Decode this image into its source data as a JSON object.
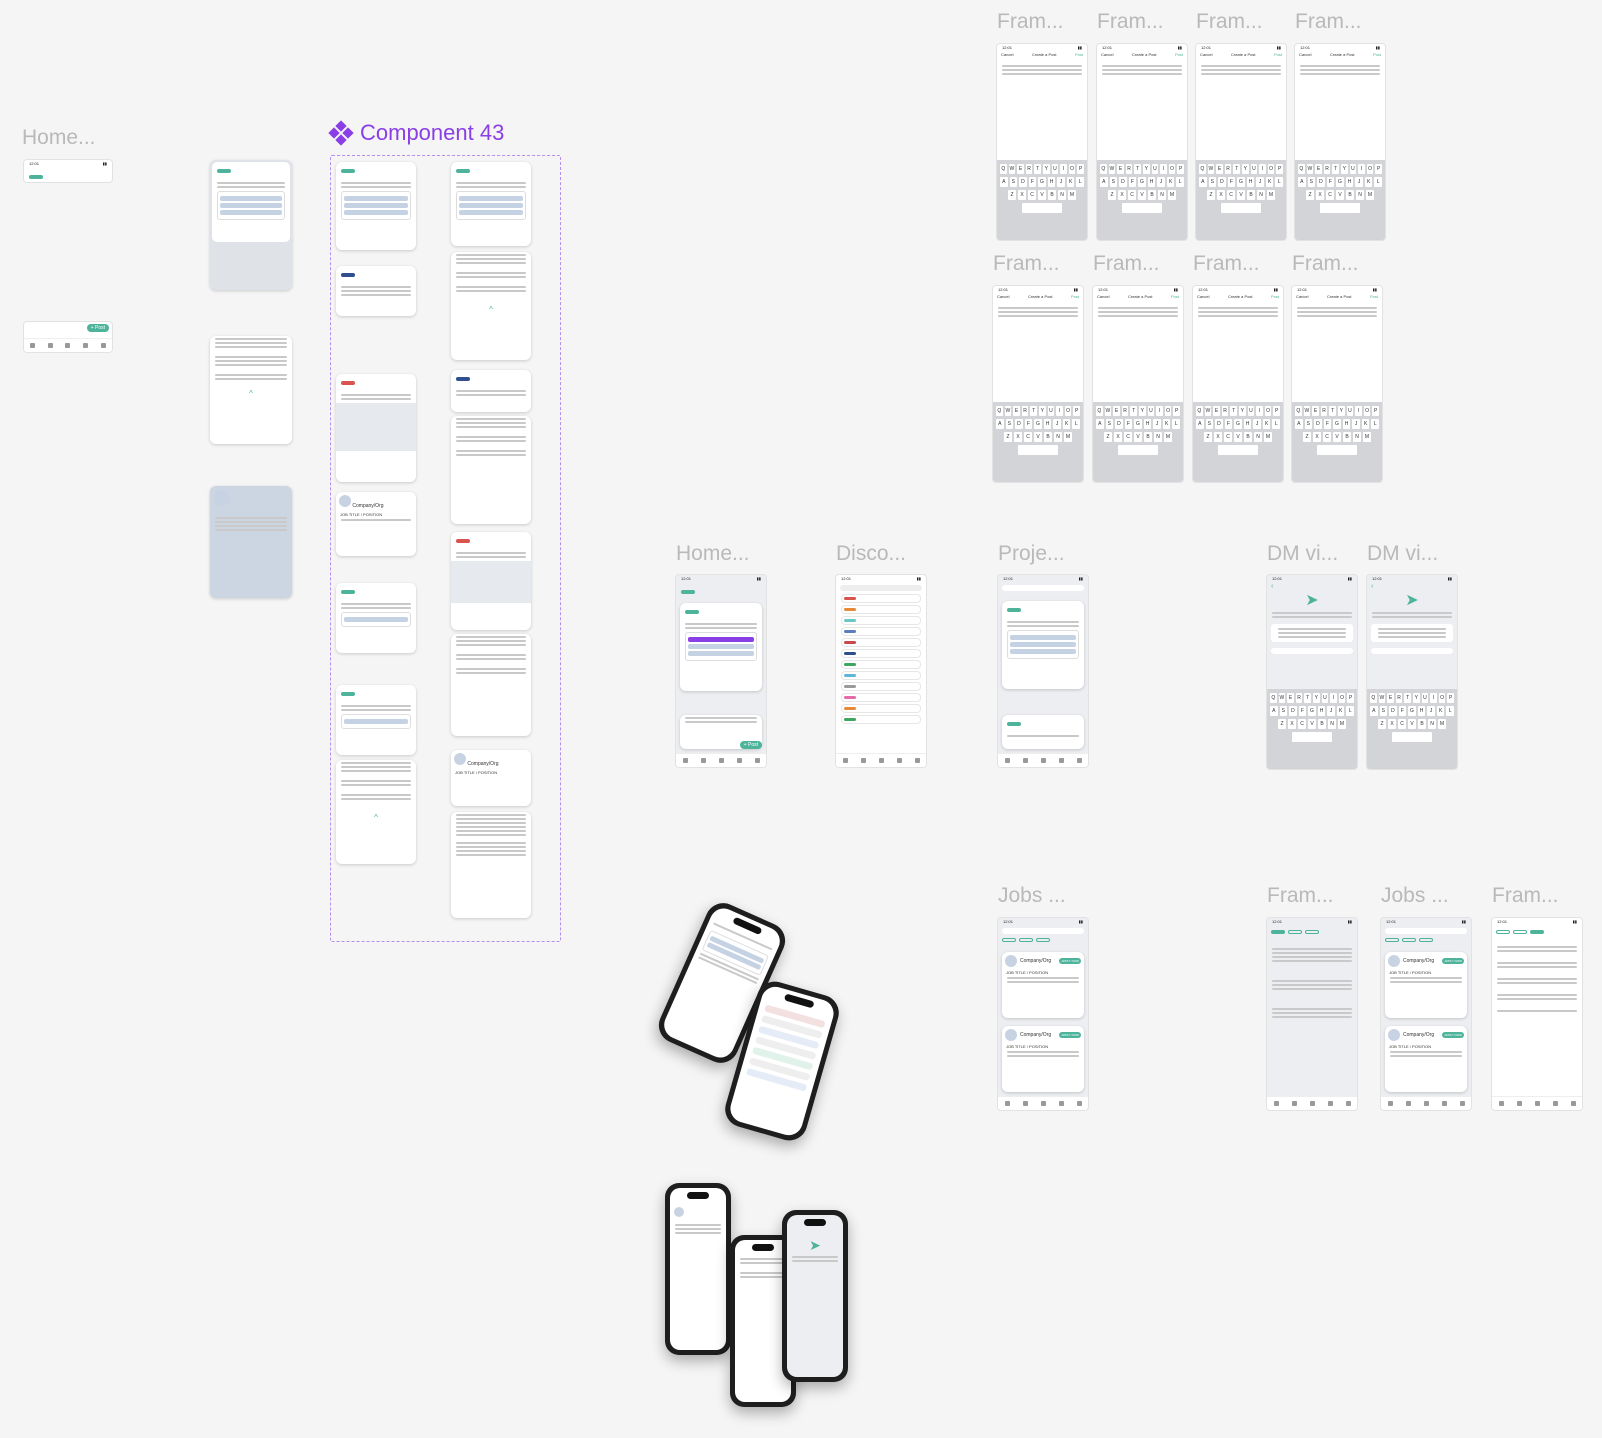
{
  "labels": {
    "home_left": "Home...",
    "component": "Component 43",
    "frame": "Fram...",
    "home": "Home...",
    "discover": "Disco...",
    "projects": "Proje...",
    "dm": "DM vi...",
    "jobs": "Jobs ..."
  },
  "status": {
    "time": "12:01"
  },
  "compose": {
    "cancel": "Cancel",
    "title": "Create a Post",
    "post": "Post"
  },
  "nav": {
    "post_button": "+ Post"
  },
  "job": {
    "company": "Company/Org",
    "title": "JOB TITLE / POSITION",
    "apply": "APPLY NOW"
  },
  "keyboard": {
    "row1": [
      "Q",
      "W",
      "E",
      "R",
      "T",
      "Y",
      "U",
      "I",
      "O",
      "P"
    ],
    "row2": [
      "A",
      "S",
      "D",
      "F",
      "G",
      "H",
      "J",
      "K",
      "L"
    ],
    "row3": [
      "Z",
      "X",
      "C",
      "V",
      "B",
      "N",
      "M"
    ]
  },
  "colors": {
    "accent": "#4db39a",
    "component": "#8a3ee6",
    "canvas": "#f5f5f5"
  }
}
